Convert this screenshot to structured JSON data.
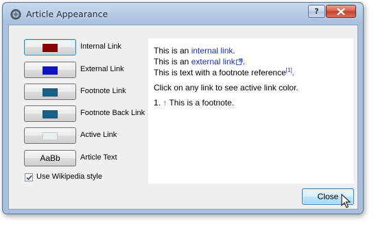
{
  "window": {
    "title": "Article Appearance",
    "help_glyph": "?"
  },
  "buttons": [
    {
      "label": "Internal Link",
      "swatch_color": "#8b0000",
      "selected": true
    },
    {
      "label": "External Link",
      "swatch_color": "#1010c8",
      "selected": false
    },
    {
      "label": "Footnote Link",
      "swatch_color": "#1a5f86",
      "selected": false
    },
    {
      "label": "Footnote Back Link",
      "swatch_color": "#1a5f86",
      "selected": false
    },
    {
      "label": "Active Link",
      "swatch_color": "#e9f0ef",
      "selected": false
    },
    {
      "label": "Article Text",
      "button_text": "AaBb",
      "selected": false
    }
  ],
  "wikipedia_style": {
    "label": "Use Wikipedia style",
    "checked": true
  },
  "preview": {
    "line1_prefix": "This is an ",
    "internal_link": "internal link",
    "line1_suffix": ".",
    "line2_prefix": "This is an ",
    "external_link": "external link",
    "line2_suffix": ".",
    "line3_prefix": "This is text with a footnote reference",
    "footnote_ref": "[1]",
    "line3_suffix": ".",
    "instruction": "Click on any link to see active link color.",
    "footnote_number": "1.",
    "backlink_arrow": "↑",
    "footnote_text": " This is a footnote."
  },
  "close_button": "Close",
  "icons": {
    "app": "app-icon",
    "external": "external-link-icon",
    "cursor": "mouse-cursor-icon"
  }
}
